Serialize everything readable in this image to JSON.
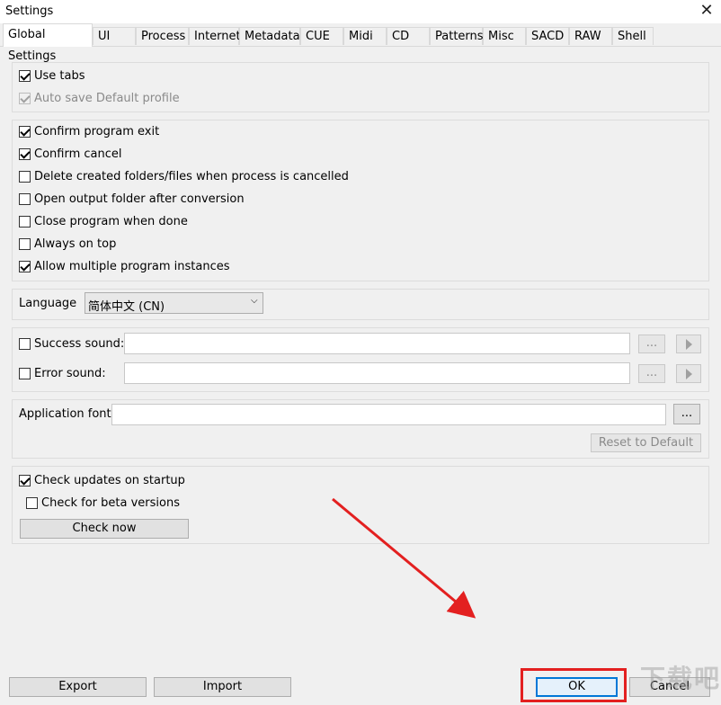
{
  "window": {
    "title": "Settings"
  },
  "tabs": [
    "Global Settings",
    "UI",
    "Process",
    "Internet",
    "Metadata",
    "CUE",
    "Midi",
    "CD",
    "Patterns",
    "Misc",
    "SACD",
    "RAW",
    "Shell"
  ],
  "active_tab": "Global Settings",
  "group1": {
    "use_tabs": {
      "label": "Use tabs",
      "checked": true
    },
    "auto_save": {
      "label": "Auto save Default profile",
      "checked": true,
      "disabled": true
    }
  },
  "group2": [
    {
      "label": "Confirm program exit",
      "checked": true
    },
    {
      "label": "Confirm cancel",
      "checked": true
    },
    {
      "label": "Delete created folders/files when process is cancelled",
      "checked": false
    },
    {
      "label": "Open output folder after conversion",
      "checked": false
    },
    {
      "label": "Close program when done",
      "checked": false
    },
    {
      "label": "Always on top",
      "checked": false
    },
    {
      "label": "Allow multiple program instances",
      "checked": true
    }
  ],
  "language": {
    "label": "Language",
    "value": "简体中文 (CN)"
  },
  "sounds": {
    "success": {
      "label": "Success sound:",
      "checked": false,
      "value": ""
    },
    "error": {
      "label": "Error sound:",
      "checked": false,
      "value": ""
    },
    "browse_label": "...",
    "play_icon": "play-icon"
  },
  "font": {
    "label": "Application font:",
    "value": "",
    "browse_label": "...",
    "reset_label": "Reset to Default"
  },
  "updates": {
    "check_startup": {
      "label": "Check updates on startup",
      "checked": true
    },
    "beta": {
      "label": "Check for beta versions",
      "checked": false
    },
    "check_now_label": "Check now"
  },
  "bottom": {
    "export_label": "Export",
    "import_label": "Import",
    "ok_label": "OK",
    "cancel_label": "Cancel"
  },
  "annotation_color": "#e32020",
  "watermark": "下载吧"
}
